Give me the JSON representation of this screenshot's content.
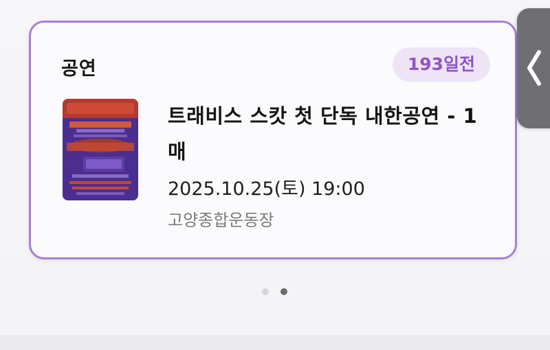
{
  "card": {
    "category": "공연",
    "d_day": "193일전",
    "poster_alt": "CIRCUS MAXIMUS TOUR 25 poster",
    "title": "트래비스 스캇 첫 단독 내한공연 - 1매",
    "datetime": "2025.10.25(토) 19:00",
    "venue": "고양종합운동장"
  },
  "pagination": {
    "total": 2,
    "active": 2
  },
  "colors": {
    "accent": "#a97fcf",
    "badge_bg": "#eee3f7",
    "badge_text": "#8f55c8"
  },
  "icons": {
    "side_tab": "chevron-left-icon"
  }
}
